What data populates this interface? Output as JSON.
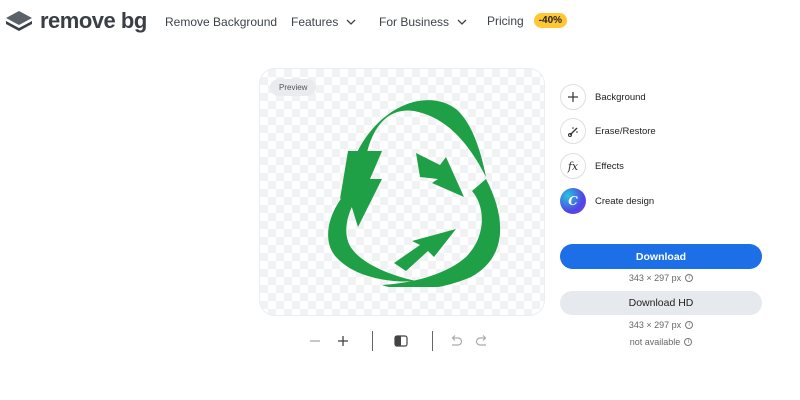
{
  "brand": {
    "name_part1": "remove",
    "name_part2": "bg"
  },
  "nav": {
    "remove_background": "Remove Background",
    "features": "Features",
    "for_business": "For Business",
    "pricing": "Pricing",
    "pricing_badge": "-40%"
  },
  "preview": {
    "tag": "Preview"
  },
  "tools": {
    "background": "Background",
    "erase_restore": "Erase/Restore",
    "effects_glyph": "fx",
    "effects": "Effects",
    "create_design_glyph": "C",
    "create_design": "Create design"
  },
  "download": {
    "label": "Download",
    "size": "343 × 297 px",
    "hd_label": "Download HD",
    "hd_size": "343 × 297 px",
    "hd_status": "not available"
  },
  "colors": {
    "accent": "#1d6fe8",
    "recycle_green": "#1fa046",
    "badge": "#ffc733"
  },
  "icons": [
    "logo-layers-icon",
    "chevron-down-icon",
    "plus-icon",
    "erase-brush-icon",
    "fx-icon",
    "canva-icon",
    "info-icon",
    "zoom-out-icon",
    "zoom-in-icon",
    "compare-icon",
    "undo-icon",
    "redo-icon"
  ]
}
